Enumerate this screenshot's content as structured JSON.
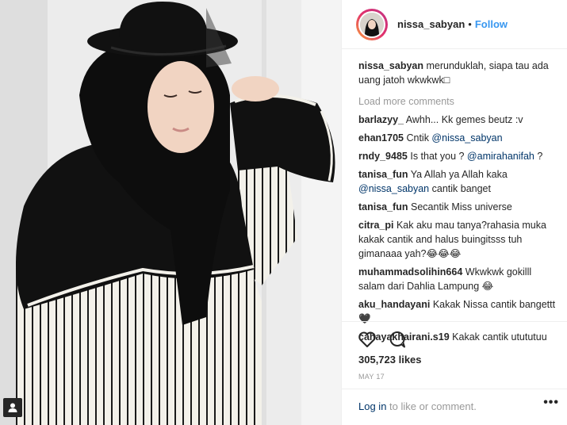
{
  "post": {
    "username": "nissa_sabyan",
    "separator": "•",
    "follow_label": "Follow",
    "caption_user": "nissa_sabyan",
    "caption_text": "merunduklah, siapa tau ada uang jatoh wkwkwk□",
    "load_more": "Load more comments",
    "likes": "305,723 likes",
    "date": "MAY 17",
    "login_link": "Log in",
    "login_rest": " to like or comment.",
    "more_icon": "•••"
  },
  "comments": [
    {
      "user": "barlazyy_",
      "text": "Awhh... Kk gemes beutz :v"
    },
    {
      "user": "ehan1705",
      "text": "Cntik ",
      "mention": "@nissa_sabyan",
      "after": ""
    },
    {
      "user": "rndy_9485",
      "text": "Is that you ? ",
      "mention": "@amirahanifah",
      "after": " ?"
    },
    {
      "user": "tanisa_fun",
      "text": "Ya Allah ya Allah kaka ",
      "mention": "@nissa_sabyan",
      "after": " cantik banget"
    },
    {
      "user": "tanisa_fun",
      "text": "Secantik Miss universe"
    },
    {
      "user": "citra_pi",
      "text": "Kak aku mau tanya?rahasia muka kakak cantik and halus buingitsss tuh gimanaaa yah?😂😂😂"
    },
    {
      "user": "muhammadsolihin664",
      "text": "Wkwkwk gokilll salam dari Dahlia Lampung 😂"
    },
    {
      "user": "aku_handayani",
      "text": "Kakak Nissa cantik bangettt🖤"
    },
    {
      "user": "cahayakhairani.s19",
      "text": "Kakak cantik utututuu"
    }
  ],
  "icons": {
    "heart": "heart-icon",
    "comment": "comment-icon",
    "user_tag": "user-tag-icon",
    "more": "more-options-icon"
  },
  "colors": {
    "follow": "#3897f0",
    "mention": "#003569",
    "muted": "#999999"
  }
}
